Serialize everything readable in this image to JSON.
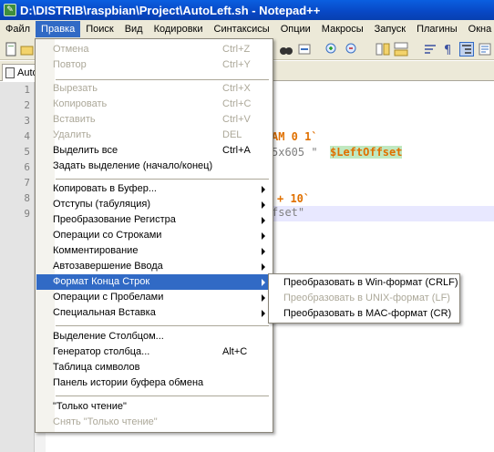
{
  "window": {
    "title": "D:\\DISTRIB\\raspbian\\Project\\AutoLeft.sh - Notepad++"
  },
  "menubar": [
    "Файл",
    "Правка",
    "Поиск",
    "Вид",
    "Кодировки",
    "Синтаксисы",
    "Опции",
    "Макросы",
    "Запуск",
    "Плагины",
    "Окна"
  ],
  "tab": {
    "label": "Auto"
  },
  "editor": {
    "line_numbers": [
      "1",
      "2",
      "3",
      "4",
      "5",
      "6",
      "7",
      "8",
      "9"
    ],
    "code_fragments": [
      "AM 0 1`",
      "5x605 \" ",
      "$LeftOffset",
      "+ 10`",
      "fset\""
    ]
  },
  "edit_menu": {
    "items": [
      {
        "label": "Отмена",
        "shortcut": "Ctrl+Z",
        "disabled": true
      },
      {
        "label": "Повтор",
        "shortcut": "Ctrl+Y",
        "disabled": true
      },
      {
        "label": "Вырезать",
        "shortcut": "Ctrl+X",
        "disabled": true
      },
      {
        "label": "Копировать",
        "shortcut": "Ctrl+C",
        "disabled": true
      },
      {
        "label": "Вставить",
        "shortcut": "Ctrl+V",
        "disabled": true
      },
      {
        "label": "Удалить",
        "shortcut": "DEL",
        "disabled": true
      },
      {
        "label": "Выделить все",
        "shortcut": "Ctrl+A",
        "disabled": false
      },
      {
        "label": "Задать выделение (начало/конец)",
        "shortcut": "",
        "disabled": false
      },
      {
        "label": "Копировать в Буфер...",
        "shortcut": "",
        "disabled": false
      },
      {
        "label": "Отступы (табуляция)",
        "shortcut": "",
        "disabled": false
      },
      {
        "label": "Преобразование Регистра",
        "shortcut": "",
        "disabled": false
      },
      {
        "label": "Операции со Строками",
        "shortcut": "",
        "disabled": false
      },
      {
        "label": "Комментирование",
        "shortcut": "",
        "disabled": false
      },
      {
        "label": "Автозавершение Ввода",
        "shortcut": "",
        "disabled": false
      },
      {
        "label": "Формат Конца Строк",
        "shortcut": "",
        "disabled": false
      },
      {
        "label": "Операции с Пробелами",
        "shortcut": "",
        "disabled": false
      },
      {
        "label": "Специальная Вставка",
        "shortcut": "",
        "disabled": false
      },
      {
        "label": "Выделение Столбцом...",
        "shortcut": "",
        "disabled": false
      },
      {
        "label": "Генератор столбца...",
        "shortcut": "Alt+C",
        "disabled": false
      },
      {
        "label": "Таблица символов",
        "shortcut": "",
        "disabled": false
      },
      {
        "label": "Панель истории буфера обмена",
        "shortcut": "",
        "disabled": false
      },
      {
        "label": "\"Только чтение\"",
        "shortcut": "",
        "disabled": false
      },
      {
        "label": "Снять \"Только чтение\"",
        "shortcut": "",
        "disabled": true
      }
    ]
  },
  "eol_submenu": {
    "items": [
      {
        "label": "Преобразовать в Win-формат (CRLF)",
        "disabled": false
      },
      {
        "label": "Преобразовать в UNIX-формат (LF)",
        "disabled": true
      },
      {
        "label": "Преобразовать в MAC-формат (CR)",
        "disabled": false
      }
    ]
  },
  "colors": {
    "highlight": "#316ac5",
    "disabled_text": "#aca899",
    "menubar_bg": "#ece9d8"
  }
}
